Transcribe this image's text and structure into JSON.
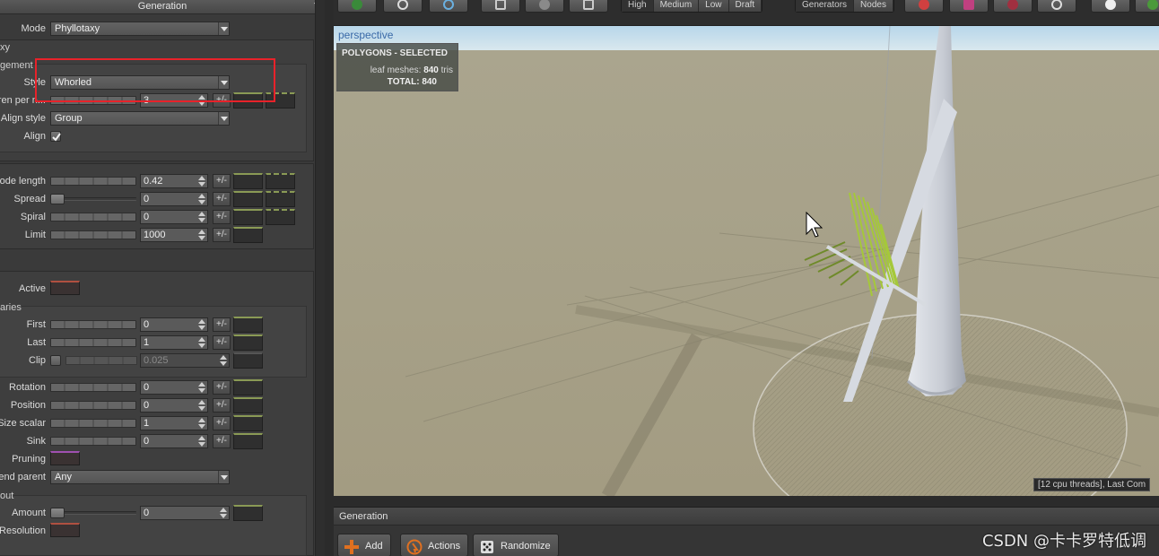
{
  "panel": {
    "title": "Generation"
  },
  "props": {
    "mode_label": "Mode",
    "mode_value": "Phyllotaxy",
    "section_phyllotaxy": "xy",
    "section_arrangement": "gement",
    "style_label": "Style",
    "style_value": "Whorled",
    "children_label": "ren per n...",
    "children_value": "3",
    "align_style_label": "Align style",
    "align_style_value": "Group",
    "align_label": "Align",
    "node_length_label": "ode length",
    "node_length_value": "0.42",
    "spread_label": "Spread",
    "spread_value": "0",
    "spiral_label": "Spiral",
    "spiral_value": "0",
    "limit_label": "Limit",
    "limit_value": "1000",
    "active_label": "Active",
    "section_boundaries": "aries",
    "first_label": "First",
    "first_value": "0",
    "last_label": "Last",
    "last_value": "1",
    "clip_label": "Clip",
    "clip_value": "0.025",
    "rotation_label": "Rotation",
    "rotation_value": "0",
    "position_label": "Position",
    "position_value": "0",
    "size_scalar_label": "Size scalar",
    "size_scalar_value": "1",
    "sink_label": "Sink",
    "sink_value": "0",
    "pruning_label": "Pruning",
    "end_parent_label": "end parent",
    "end_parent_value": "Any",
    "section_out": "out",
    "amount_label": "Amount",
    "amount_value": "0",
    "resolution_label": "Resolution",
    "pm": "+/-"
  },
  "toolbar": {
    "quality": [
      "High",
      "Medium",
      "Low",
      "Draft"
    ],
    "view_modes": [
      "Generators",
      "Nodes"
    ]
  },
  "viewport": {
    "camera_label": "perspective",
    "stats_title": "POLYGONS - SELECTED",
    "leaf_label": "leaf meshes:",
    "leaf_value": "840",
    "leaf_unit": "tris",
    "total_label": "TOTAL:",
    "total_value": "840",
    "status": "[12 cpu threads], Last Com"
  },
  "bottom": {
    "title": "Generation",
    "add": "Add",
    "actions": "Actions",
    "randomize": "Randomize"
  },
  "watermark": "CSDN @卡卡罗特低调",
  "colors": {
    "highlight": "#e8222a",
    "sky": "#cde3f0",
    "ground": "#a39e86"
  }
}
